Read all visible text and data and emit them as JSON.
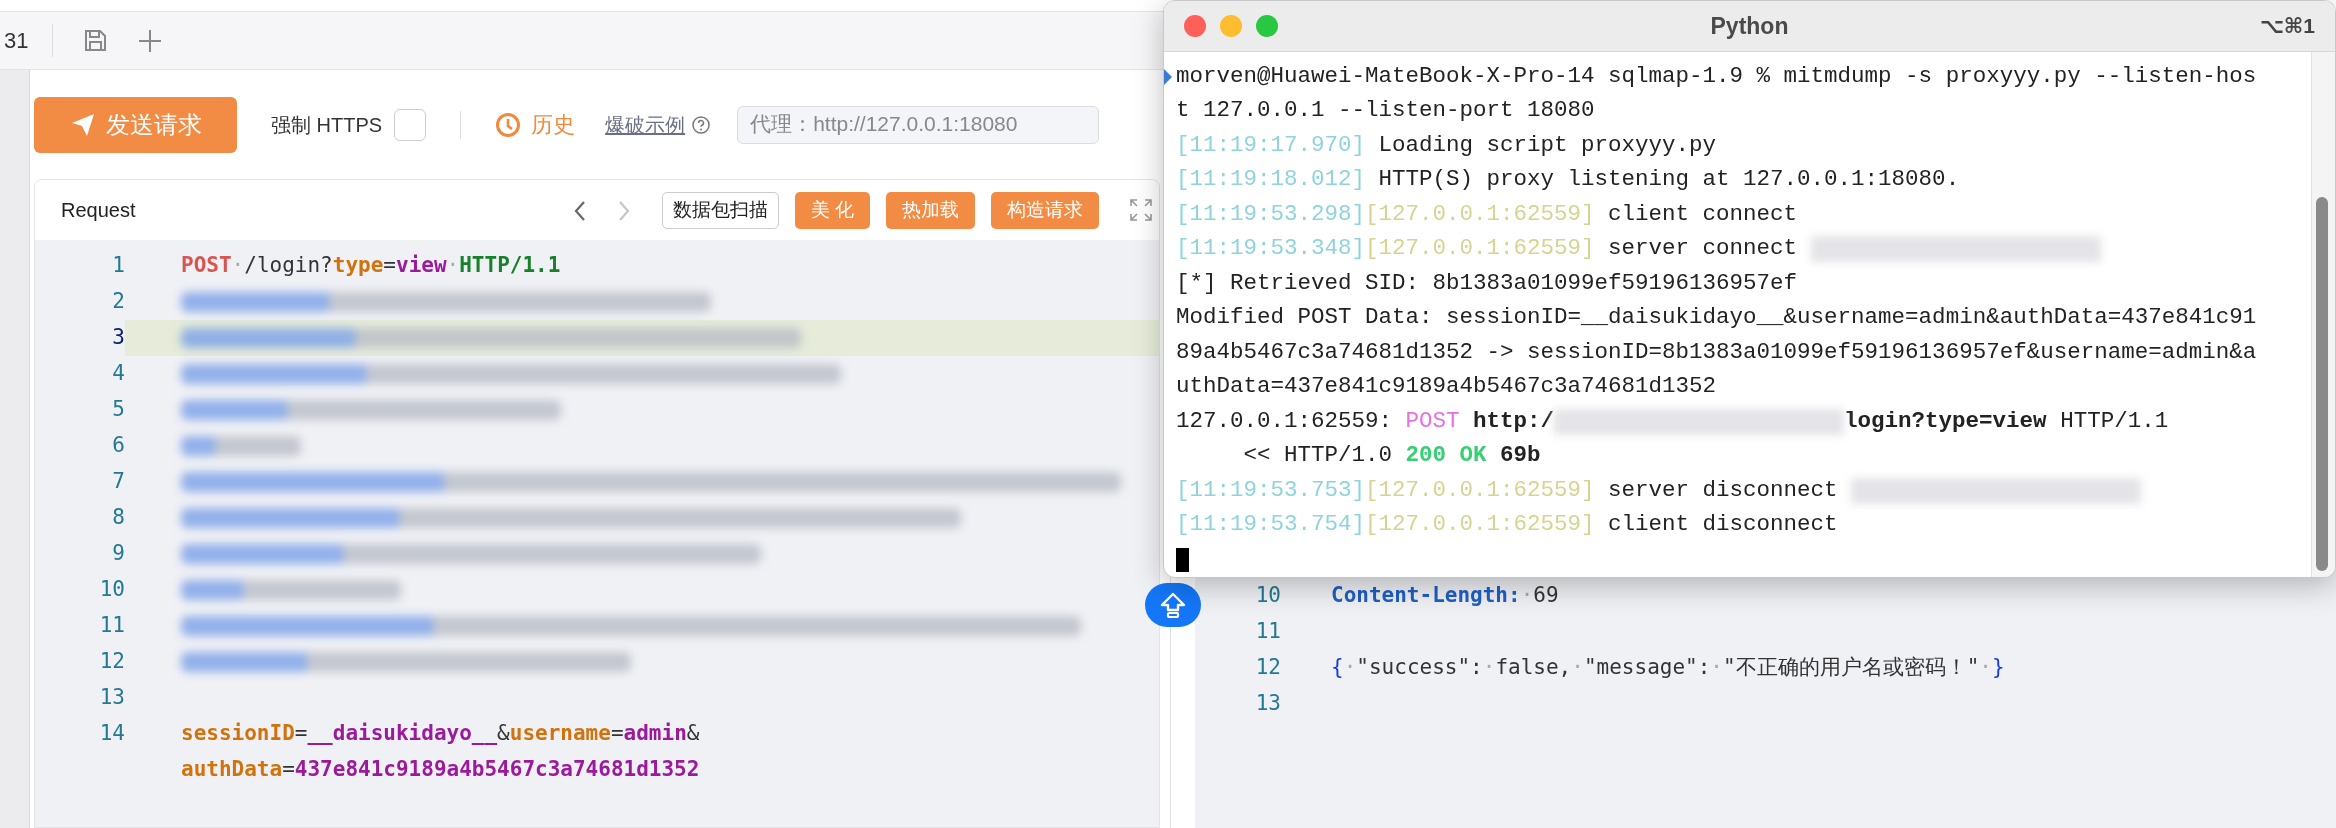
{
  "tab_bar": {
    "tab_label": "31"
  },
  "toolbar": {
    "send_button": "发送请求",
    "force_https": {
      "label": "强制 HTTPS",
      "checked": false
    },
    "history_button": "历史",
    "examples_link": "爆破示例",
    "proxy_field": {
      "placeholder": "代理：http://127.0.0.1:18080"
    }
  },
  "request_panel": {
    "title": "Request",
    "back_disabled": false,
    "forward_disabled": true,
    "buttons": [
      {
        "label": "数据包扫描",
        "kind": "outline"
      },
      {
        "label": "美 化",
        "kind": "filled"
      },
      {
        "label": "热加载",
        "kind": "filled"
      },
      {
        "label": "构造请求",
        "kind": "filled"
      }
    ],
    "lines": [
      {
        "number": "1",
        "active": false,
        "kind": "code",
        "tokens": [
          {
            "kind": "method",
            "text": "POST"
          },
          {
            "kind": "ws",
            "text": "·"
          },
          {
            "kind": "plain",
            "text": "/login?"
          },
          {
            "kind": "key",
            "text": "type"
          },
          {
            "kind": "plain",
            "text": "="
          },
          {
            "kind": "value",
            "text": "view"
          },
          {
            "kind": "ws",
            "text": "·"
          },
          {
            "kind": "version",
            "text": "HTTP/1.1"
          }
        ]
      },
      {
        "number": "2",
        "active": false,
        "kind": "blurred"
      },
      {
        "number": "3",
        "active": true,
        "kind": "blurred"
      },
      {
        "number": "4",
        "active": false,
        "kind": "blurred"
      },
      {
        "number": "5",
        "active": false,
        "kind": "blurred"
      },
      {
        "number": "6",
        "active": false,
        "kind": "blurred"
      },
      {
        "number": "7",
        "active": false,
        "kind": "blurred"
      },
      {
        "number": "8",
        "active": false,
        "kind": "blurred"
      },
      {
        "number": "9",
        "active": false,
        "kind": "blurred"
      },
      {
        "number": "10",
        "active": false,
        "kind": "blurred"
      },
      {
        "number": "11",
        "active": false,
        "kind": "blurred"
      },
      {
        "number": "12",
        "active": false,
        "kind": "blurred"
      },
      {
        "number": "13",
        "active": false,
        "kind": "code"
      },
      {
        "number": "14",
        "active": false,
        "kind": "code",
        "tokens": [
          {
            "kind": "key",
            "text": "sessionID"
          },
          {
            "kind": "plain",
            "text": "="
          },
          {
            "kind": "value",
            "text": "__daisukidayo__"
          },
          {
            "kind": "plain",
            "text": "&"
          },
          {
            "kind": "key",
            "text": "username"
          },
          {
            "kind": "plain",
            "text": "="
          },
          {
            "kind": "value",
            "text": "admin"
          },
          {
            "kind": "plain",
            "text": "&"
          }
        ]
      },
      {
        "active": false,
        "kind": "code",
        "tokens": [
          {
            "kind": "key",
            "text": "authData"
          },
          {
            "kind": "plain",
            "text": "="
          },
          {
            "kind": "value",
            "text": "437e841c9189a4b5467c3a74681d1352"
          }
        ]
      }
    ]
  },
  "response_panel": {
    "lines": [
      {
        "number": "10",
        "tokens": [
          {
            "kind": "header",
            "text": "Content-Length:"
          },
          {
            "kind": "ws",
            "text": "·"
          },
          {
            "kind": "plain",
            "text": "69"
          }
        ]
      },
      {
        "number": "11"
      },
      {
        "number": "12",
        "tokens": [
          {
            "kind": "brace",
            "text": "{"
          },
          {
            "kind": "ws",
            "text": "·"
          },
          {
            "kind": "plain",
            "text": "\"success\":"
          },
          {
            "kind": "ws",
            "text": "·"
          },
          {
            "kind": "plain",
            "text": "false,"
          },
          {
            "kind": "ws",
            "text": "·"
          },
          {
            "kind": "plain",
            "text": "\"message\":"
          },
          {
            "kind": "ws",
            "text": "·"
          },
          {
            "kind": "plain",
            "text": "\"不正确的用户名或密码！\""
          },
          {
            "kind": "ws",
            "text": "·"
          },
          {
            "kind": "brace",
            "text": "}"
          }
        ]
      },
      {
        "number": "13"
      }
    ]
  },
  "terminal": {
    "title": "Python",
    "shortcut": "⌥⌘1",
    "lines": [
      {
        "segments": [
          {
            "kind": "plain",
            "text": "morven@Huawei-MateBook-X-Pro-14 sqlmap-1.9 % mitmdump -s proxyyy.py --listen-hos"
          }
        ]
      },
      {
        "segments": [
          {
            "kind": "plain",
            "text": "t 127.0.0.1 --listen-port 18080"
          }
        ]
      },
      {
        "segments": [
          {
            "kind": "time",
            "text": "[11:19:17.970]"
          },
          {
            "kind": "plain",
            "text": " Loading script proxyyy.py"
          }
        ]
      },
      {
        "segments": [
          {
            "kind": "time",
            "text": "[11:19:18.012]"
          },
          {
            "kind": "plain",
            "text": " HTTP(S) proxy listening at 127.0.0.1:18080."
          }
        ]
      },
      {
        "segments": [
          {
            "kind": "time",
            "text": "[11:19:53.298]"
          },
          {
            "kind": "addr",
            "text": "[127.0.0.1:62559]"
          },
          {
            "kind": "plain",
            "text": " client connect"
          }
        ]
      },
      {
        "segments": [
          {
            "kind": "time",
            "text": "[11:19:53.348]"
          },
          {
            "kind": "addr",
            "text": "[127.0.0.1:62559]"
          },
          {
            "kind": "plain",
            "text": " server connect "
          },
          {
            "kind": "blurred"
          }
        ]
      },
      {
        "segments": [
          {
            "kind": "plain",
            "text": "[*] Retrieved SID: 8b1383a01099ef59196136957ef"
          }
        ]
      },
      {
        "segments": [
          {
            "kind": "plain",
            "text": "Modified POST Data: sessionID=__daisukidayo__&username=admin&authData=437e841c91"
          }
        ]
      },
      {
        "segments": [
          {
            "kind": "plain",
            "text": "89a4b5467c3a74681d1352 -> sessionID=8b1383a01099ef59196136957ef&username=admin&a"
          }
        ]
      },
      {
        "segments": [
          {
            "kind": "plain",
            "text": "uthData=437e841c9189a4b5467c3a74681d1352"
          }
        ]
      },
      {
        "segments": [
          {
            "kind": "plain",
            "text": "127.0.0.1:62559: "
          },
          {
            "kind": "method",
            "text": "POST"
          },
          {
            "kind": "bold",
            "text": " http:/"
          },
          {
            "kind": "blurred"
          },
          {
            "kind": "bold",
            "text": "login?type=view"
          },
          {
            "kind": "plain",
            "text": " HTTP/1.1"
          }
        ]
      },
      {
        "segments": [
          {
            "kind": "plain",
            "text": "     << HTTP/1.0 "
          },
          {
            "kind": "status",
            "text": "200 OK"
          },
          {
            "kind": "bold",
            "text": " 69b"
          }
        ]
      },
      {
        "segments": [
          {
            "kind": "time",
            "text": "[11:19:53.753]"
          },
          {
            "kind": "addr",
            "text": "[127.0.0.1:62559]"
          },
          {
            "kind": "plain",
            "text": " server disconnect "
          },
          {
            "kind": "blurred"
          }
        ]
      },
      {
        "segments": [
          {
            "kind": "time",
            "text": "[11:19:53.754]"
          },
          {
            "kind": "addr",
            "text": "[127.0.0.1:62559]"
          },
          {
            "kind": "plain",
            "text": " client disconnect"
          }
        ]
      }
    ]
  }
}
